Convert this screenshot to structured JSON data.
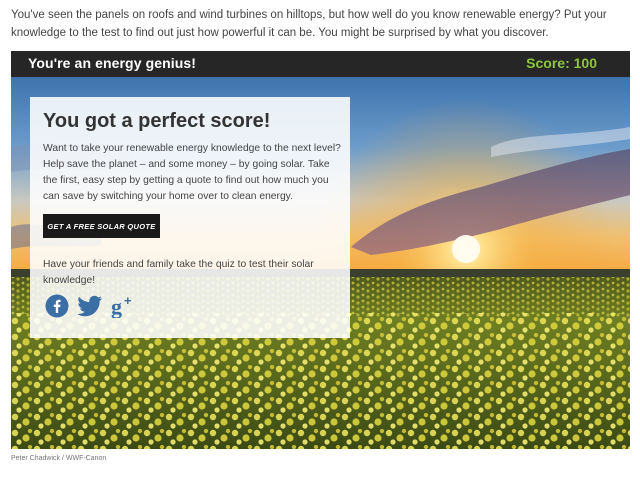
{
  "intro": {
    "text": "You've seen the panels on roofs and wind turbines on hilltops, but how well do you know renewable energy? Put your knowledge to the test to find out just how powerful it can be. You might be surprised by what you discover."
  },
  "result_bar": {
    "title": "You're an energy genius!",
    "score_text": "Score: 100",
    "score_color": "#8dc63f"
  },
  "card": {
    "heading": "You got a perfect score!",
    "body": "Want to take your renewable energy knowledge to the next level? Help save the planet – and some money – by going solar. Take the first, easy step by getting a quote to find out how much you can save by switching your home over to clean energy.",
    "cta_label": "GET A FREE SOLAR QUOTE",
    "share_text": "Have your friends and family take the quiz to test their solar knowledge!",
    "social_icons": [
      "facebook-icon",
      "twitter-icon",
      "google-plus-icon"
    ],
    "social_color": "#3b6ea5"
  },
  "photo_credit": "Peter Chadwick / WWF-Canon"
}
